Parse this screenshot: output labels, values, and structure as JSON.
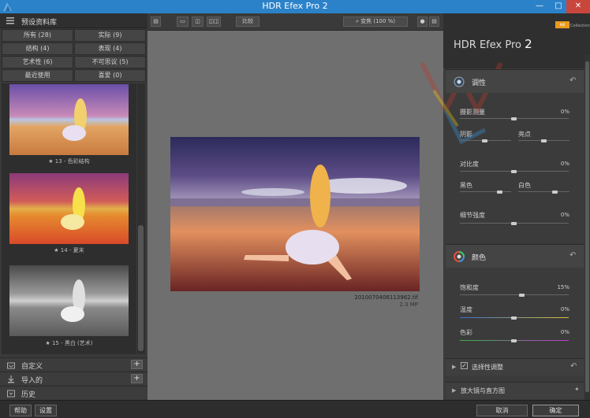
{
  "window": {
    "title": "HDR Efex Pro 2"
  },
  "library": {
    "title": "预设资料库",
    "categories": [
      "所有 (28)",
      "实际 (9)",
      "结构 (4)",
      "表现 (4)",
      "艺术性 (6)",
      "不可思议 (5)",
      "最近使用",
      "喜爱 (0)"
    ],
    "thumbnails": [
      {
        "caption": "★ 13 - 色彩结构"
      },
      {
        "caption": "★ 14 - 夏末"
      },
      {
        "caption": "★ 15 - 黑白 (艺术)"
      }
    ],
    "sections": [
      {
        "label": "自定义",
        "plus": "+"
      },
      {
        "label": "导入的",
        "plus": "+"
      },
      {
        "label": "历史"
      }
    ]
  },
  "toolbar": {
    "compare_label": "比较",
    "zoom_label": "变焦 (100 %)"
  },
  "preview": {
    "filename": "20100704061139​62.tif",
    "size": "2.3 MP"
  },
  "panel": {
    "title_text": "HDR Efex Pro",
    "title_num": "2",
    "badge": "NIK",
    "collection": "Collection",
    "tone": {
      "label": "调性",
      "exposure": {
        "label": "摄影测量",
        "value": "0%"
      },
      "shadows_label": "阴影",
      "highlights_label": "亮点",
      "contrast": {
        "label": "对比度",
        "value": "0%"
      },
      "blacks_label": "黑色",
      "whites_label": "白色",
      "detail": {
        "label": "细节强度",
        "value": "0%"
      }
    },
    "color": {
      "label": "颜色",
      "saturation": {
        "label": "饱和度",
        "value": "15%"
      },
      "temperature": {
        "label": "温度",
        "value": "0%"
      },
      "tint": {
        "label": "色彩",
        "value": "0%"
      }
    },
    "selective": {
      "label": "选择性调整"
    },
    "loupe": {
      "label": "放大镜与直方图"
    }
  },
  "bottom": {
    "help": "帮助",
    "settings": "设置",
    "cancel": "取消",
    "ok": "确定"
  },
  "colors": {
    "titlebar": "#2c82c9",
    "accent": "#e89b1e"
  }
}
